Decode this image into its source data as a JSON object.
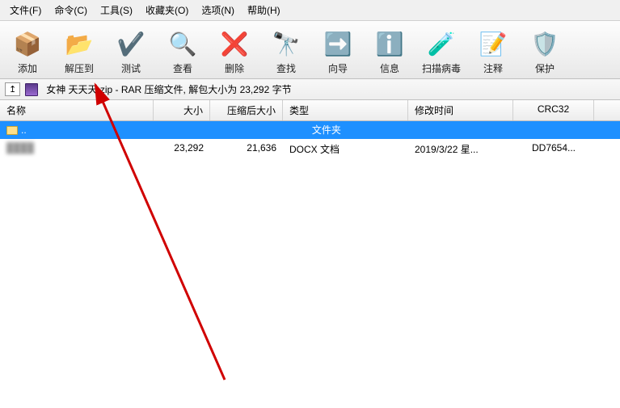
{
  "menu": {
    "file": "文件(F)",
    "command": "命令(C)",
    "tools": "工具(S)",
    "favorites": "收藏夹(O)",
    "options": "选项(N)",
    "help": "帮助(H)"
  },
  "toolbar": {
    "add": "添加",
    "extract": "解压到",
    "test": "测试",
    "view": "查看",
    "delete": "删除",
    "find": "查找",
    "wizard": "向导",
    "info": "信息",
    "scan": "扫描病毒",
    "comment": "注释",
    "protect": "保护"
  },
  "icons": {
    "add": "📦",
    "extract": "📂",
    "test": "✔️",
    "view": "🔍",
    "delete": "❌",
    "find": "🔭",
    "wizard": "➡️",
    "info": "ℹ️",
    "scan": "🧪",
    "comment": "📝",
    "protect": "🛡️"
  },
  "pathbar": {
    "up_label": "↥",
    "text": "女神 天天天.zip - RAR 压缩文件, 解包大小为 23,292 字节"
  },
  "columns": {
    "name": "名称",
    "size": "大小",
    "packed": "压缩后大小",
    "type": "类型",
    "modified": "修改时间",
    "crc": "CRC32"
  },
  "rows": [
    {
      "name": "..",
      "is_folder": true,
      "size": "",
      "packed": "",
      "type": "文件夹",
      "modified": "",
      "crc": "",
      "selected": true
    },
    {
      "name": "",
      "is_folder": false,
      "size": "23,292",
      "packed": "21,636",
      "type": "DOCX 文档",
      "modified": "2019/3/22 星...",
      "crc": "DD7654...",
      "selected": false,
      "blurName": true
    }
  ]
}
